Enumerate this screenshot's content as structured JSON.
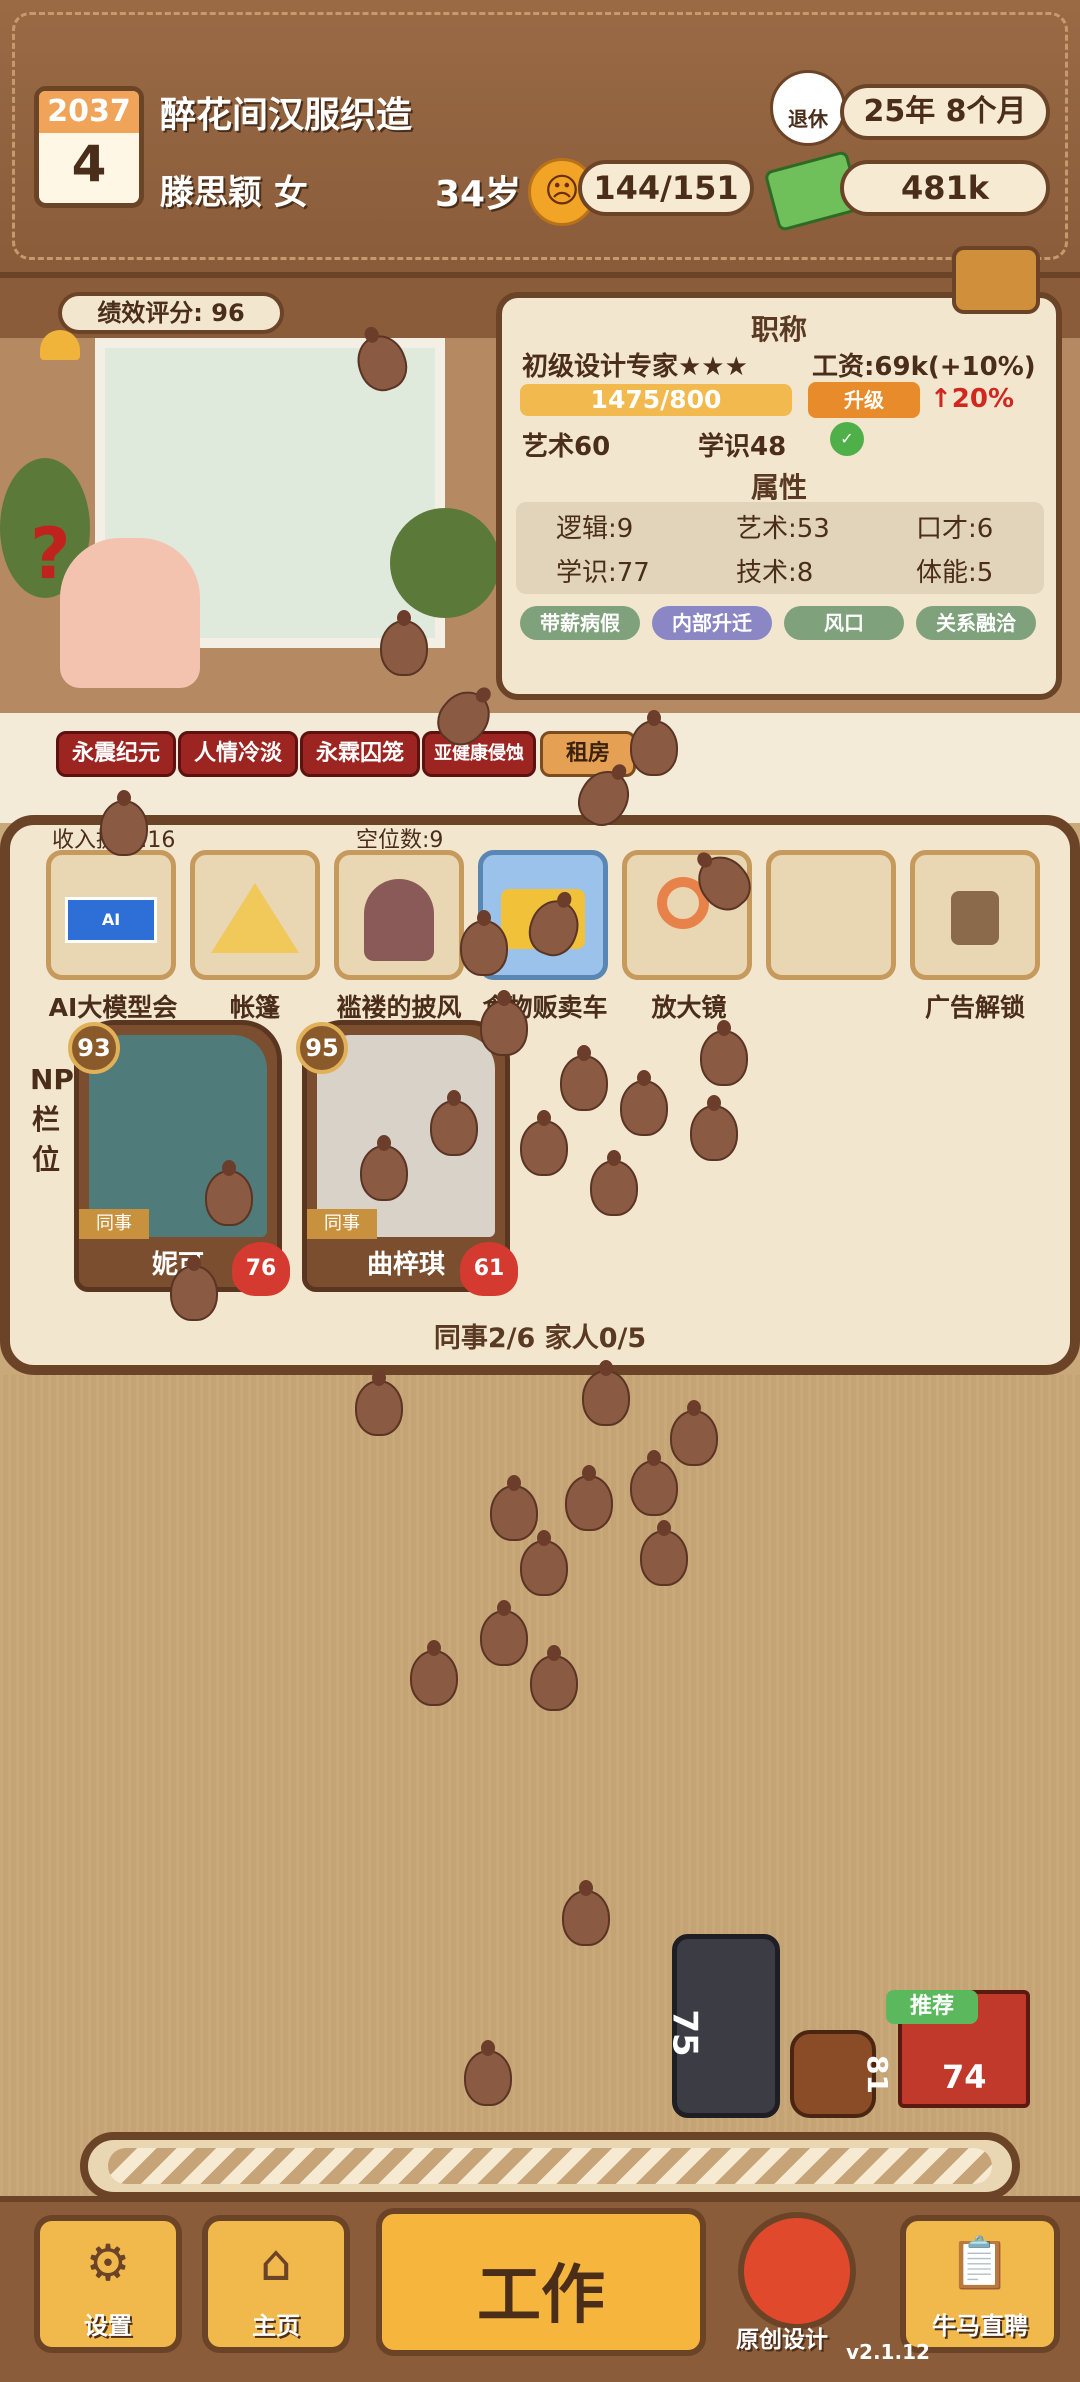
{
  "header": {
    "calendar_year": "2037",
    "calendar_month": "4",
    "company": "醉花间汉服织造",
    "person": "滕思颖 女",
    "age": "34岁",
    "mood": "144/151",
    "retire_label": "退休",
    "retire_time": "25年 8个月",
    "money": "481k"
  },
  "scene": {
    "performance": "绩效评分: 96",
    "question_mark": "?"
  },
  "job": {
    "title_heading": "职称",
    "title": "初级设计专家★★★",
    "salary": "工资:69k(+10%)",
    "progress": "1475/800",
    "upgrade": "升级",
    "boost": "↑20%",
    "req_art": "艺术60",
    "req_knowledge": "学识48",
    "attr_heading": "属性",
    "attrs": [
      "逻辑:9",
      "艺术:53",
      "口才:6",
      "学识:77",
      "技术:8",
      "体能:5"
    ],
    "tags": [
      "带薪病假",
      "内部升迁",
      "风口",
      "关系融洽"
    ]
  },
  "traits": [
    "永震纪元",
    "人情冷淡",
    "永霖囚笼",
    "亚健康侵蚀",
    "租房"
  ],
  "items": {
    "income_label": "收入提升:16",
    "vacancy_label": "空位数:9",
    "slots": [
      "AI大模型会员",
      "帐篷",
      "褴褛的披风",
      "食物贩卖车",
      "放大镜",
      "",
      "广告解锁"
    ]
  },
  "npc": {
    "side_label": "NPC栏位",
    "cards": [
      {
        "rating": "93",
        "role": "同事",
        "name": "妮可",
        "heart": "76"
      },
      {
        "rating": "95",
        "role": "同事",
        "name": "曲梓琪",
        "heart": "61"
      }
    ],
    "summary": "同事2/6 家人0/5"
  },
  "shop": {
    "case_value": "75",
    "barrel_value": "81",
    "recommend": "推荐",
    "books_value": "74"
  },
  "nav": {
    "settings": "设置",
    "home": "主页",
    "work": "工作",
    "original": "原创设计",
    "recruit": "牛马直聘",
    "version": "v2.1.12"
  },
  "colors": {
    "accent": "#f1b94b",
    "frame": "#6b4428",
    "danger": "#9d2521"
  }
}
